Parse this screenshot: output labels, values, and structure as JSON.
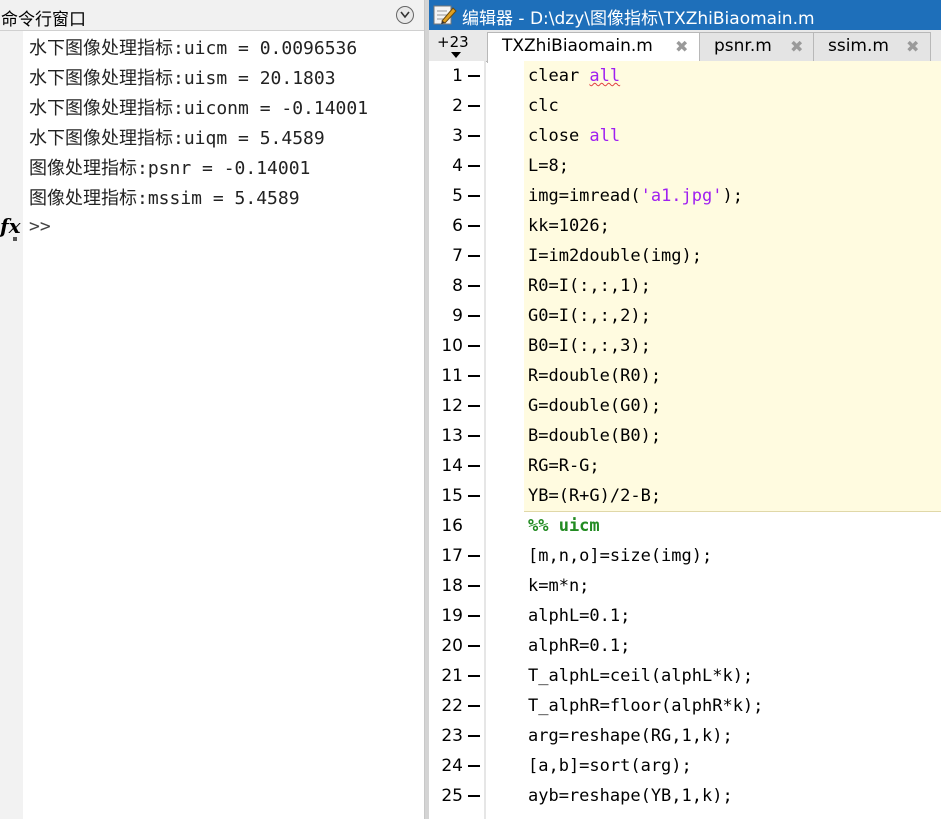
{
  "command_window": {
    "title": "命令行窗口",
    "output_lines": [
      "水下图像处理指标:uicm = 0.0096536",
      "水下图像处理指标:uism = 20.1803",
      "水下图像处理指标:uiconm = -0.14001",
      "水下图像处理指标:uiqm = 5.4589",
      "图像处理指标:psnr = -0.14001",
      "图像处理指标:mssim = 5.4589"
    ],
    "fx_label": "fx",
    "prompt": ">>"
  },
  "editor": {
    "title": "编辑器 - D:\\dzy\\图像指标\\TXZhiBiaomain.m",
    "more_tabs": "+23",
    "tabs": [
      {
        "label": "TXZhiBiaomain.m",
        "active": true
      },
      {
        "label": "psnr.m",
        "active": false
      },
      {
        "label": "ssim.m",
        "active": false
      }
    ],
    "tab_close_glyph": "✖",
    "code_lines": [
      {
        "n": "1",
        "pre": "clear ",
        "kw": "all"
      },
      {
        "n": "2",
        "text": "clc"
      },
      {
        "n": "3",
        "pre": "close ",
        "kw": "all"
      },
      {
        "n": "4",
        "text": "L=8;"
      },
      {
        "n": "5",
        "pre": "img=imread(",
        "str": "'a1.jpg'",
        "post": ");"
      },
      {
        "n": "6",
        "text": "kk=1026;"
      },
      {
        "n": "7",
        "text": "I=im2double(img);"
      },
      {
        "n": "8",
        "text": "R0=I(:,:,1);"
      },
      {
        "n": "9",
        "text": "G0=I(:,:,2);"
      },
      {
        "n": "10",
        "text": "B0=I(:,:,3);"
      },
      {
        "n": "11",
        "text": "R=double(R0);"
      },
      {
        "n": "12",
        "text": "G=double(G0);"
      },
      {
        "n": "13",
        "text": "B=double(B0);"
      },
      {
        "n": "14",
        "text": "RG=R-G;"
      },
      {
        "n": "15",
        "text": "YB=(R+G)/2-B;"
      },
      {
        "n": "16",
        "cell": "%% uicm"
      },
      {
        "n": "17",
        "text": "[m,n,o]=size(img);"
      },
      {
        "n": "18",
        "text": "k=m*n;"
      },
      {
        "n": "19",
        "text": "alphL=0.1;"
      },
      {
        "n": "20",
        "text": "alphR=0.1;"
      },
      {
        "n": "21",
        "text": "T_alphL=ceil(alphL*k);"
      },
      {
        "n": "22",
        "text": "T_alphR=floor(alphR*k);"
      },
      {
        "n": "23",
        "text": "arg=reshape(RG,1,k);"
      },
      {
        "n": "24",
        "text": "[a,b]=sort(arg);"
      },
      {
        "n": "25",
        "text": "ayb=reshape(YB,1,k);"
      }
    ]
  },
  "colors": {
    "titlebar": "#1e6fba",
    "keyword_purple": "#a020f0",
    "cell_green": "#228b22",
    "cell_highlight": "#fffbe0"
  }
}
